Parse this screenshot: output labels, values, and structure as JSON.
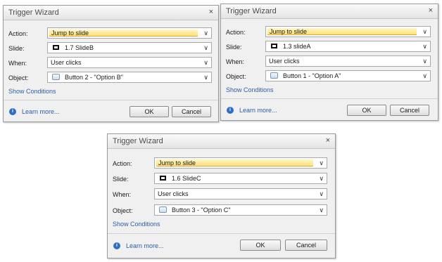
{
  "dialogs": [
    {
      "title": "Trigger Wizard",
      "close_label": "×",
      "action_label": "Action:",
      "action_value": "Jump to slide",
      "slide_label": "Slide:",
      "slide_value": "1.7 SlideB",
      "when_label": "When:",
      "when_value": "User clicks",
      "object_label": "Object:",
      "object_value": "Button 2 - \"Option B\"",
      "show_conditions": "Show Conditions",
      "learn_more": "Learn more...",
      "ok_label": "OK",
      "cancel_label": "Cancel",
      "dropdown_icon": "chevron-down-icon"
    },
    {
      "title": "Trigger Wizard",
      "close_label": "×",
      "action_label": "Action:",
      "action_value": "Jump to slide",
      "slide_label": "Slide:",
      "slide_value": "1.3 slideA",
      "when_label": "When:",
      "when_value": "User clicks",
      "object_label": "Object:",
      "object_value": "Button 1 - \"Option A\"",
      "show_conditions": "Show Conditions",
      "learn_more": "Learn more...",
      "ok_label": "OK",
      "cancel_label": "Cancel",
      "dropdown_icon": "chevron-down-icon"
    },
    {
      "title": "Trigger Wizard",
      "close_label": "×",
      "action_label": "Action:",
      "action_value": "Jump to slide",
      "slide_label": "Slide:",
      "slide_value": "1.6 SlideC",
      "when_label": "When:",
      "when_value": "User clicks",
      "object_label": "Object:",
      "object_value": "Button 3 - \"Option C\"",
      "show_conditions": "Show Conditions",
      "learn_more": "Learn more...",
      "ok_label": "OK",
      "cancel_label": "Cancel",
      "dropdown_icon": "chevron-down-icon"
    }
  ],
  "colors": {
    "highlight": "#ffe07a",
    "link": "#2a5ea8",
    "info_icon": "#2e6fc0"
  }
}
